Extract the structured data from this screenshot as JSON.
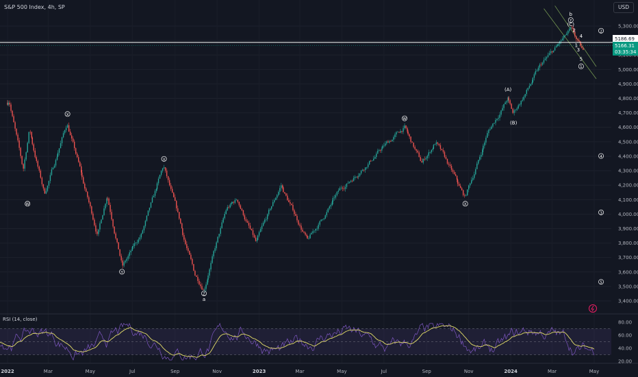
{
  "header": {
    "instrument": "S&P 500 Index, 4h, SP"
  },
  "currency": "USD",
  "price_badges": {
    "last": "5186.69",
    "current": "5166.31",
    "countdown": "03:35:34"
  },
  "rsi": {
    "label": "RSI (14, close)",
    "levels": [
      "80.00",
      "60.00",
      "40.00",
      "20.00"
    ]
  },
  "colors": {
    "up": "#26a69a",
    "down": "#ef5350",
    "rsi_line": "#7e57c2",
    "rsi_ma": "#e6df6a",
    "channel": "#9ccc65",
    "background": "#131722"
  },
  "chart_data": {
    "type": "line",
    "title": "S&P 500 Index, 4h, SP",
    "xlabel": "",
    "ylabel": "",
    "x_ticks": [
      "2022",
      "Mar",
      "May",
      "Jul",
      "Sep",
      "Nov",
      "2023",
      "Mar",
      "May",
      "Jul",
      "Sep",
      "Nov",
      "2024",
      "Mar",
      "May"
    ],
    "y_ticks": [
      "5,300.00",
      "5,200.00",
      "5,100.00",
      "5,000.00",
      "4,900.00",
      "4,800.00",
      "4,700.00",
      "4,600.00",
      "4,500.00",
      "4,400.00",
      "4,300.00",
      "4,200.00",
      "4,100.00",
      "4,000.00",
      "3,900.00",
      "3,800.00",
      "3,700.00",
      "3,600.00",
      "3,500.00",
      "3,400.00"
    ],
    "ylim": [
      3350,
      5360
    ],
    "series": [
      {
        "values": [
          [
            "2022-01-01",
            4770
          ],
          [
            "2022-01-04",
            4800
          ],
          [
            "2022-01-24",
            4300
          ],
          [
            "2022-02-02",
            4590
          ],
          [
            "2022-02-24",
            4140
          ],
          [
            "2022-03-29",
            4630
          ],
          [
            "2022-05-12",
            3860
          ],
          [
            "2022-05-26",
            4150
          ],
          [
            "2022-06-17",
            3640
          ],
          [
            "2022-07-15",
            3860
          ],
          [
            "2022-08-16",
            4325
          ],
          [
            "2022-09-30",
            3580
          ],
          [
            "2022-10-13",
            3490
          ],
          [
            "2022-11-15",
            4030
          ],
          [
            "2022-12-01",
            4100
          ],
          [
            "2022-12-28",
            3790
          ],
          [
            "2023-02-02",
            4200
          ],
          [
            "2023-03-13",
            3810
          ],
          [
            "2023-04-30",
            4170
          ],
          [
            "2023-06-30",
            4460
          ],
          [
            "2023-07-31",
            4600
          ],
          [
            "2023-08-25",
            4350
          ],
          [
            "2023-09-15",
            4500
          ],
          [
            "2023-10-27",
            4110
          ],
          [
            "2023-11-30",
            4570
          ],
          [
            "2023-12-28",
            4800
          ],
          [
            "2024-01-05",
            4690
          ],
          [
            "2024-02-15",
            5030
          ],
          [
            "2024-03-28",
            5264
          ],
          [
            "2024-04-02",
            5230
          ],
          [
            "2024-04-05",
            5200
          ],
          [
            "2024-04-15",
            5110
          ]
        ]
      }
    ],
    "wave_labels": [
      {
        "text": "W",
        "x": "2022-01-30",
        "y": 4060,
        "circled": true
      },
      {
        "text": "X",
        "x": "2022-03-29",
        "y": 4680,
        "circled": true
      },
      {
        "text": "Y",
        "x": "2022-06-16",
        "y": 3590,
        "circled": true
      },
      {
        "text": "X",
        "x": "2022-08-16",
        "y": 4370,
        "circled": true
      },
      {
        "text": "Z",
        "x": "2022-10-13",
        "y": 3440,
        "circled": true
      },
      {
        "text": "a",
        "x": "2022-10-13",
        "y": 3400,
        "circled": false
      },
      {
        "text": "W",
        "x": "2023-07-31",
        "y": 4650,
        "circled": true
      },
      {
        "text": "X",
        "x": "2023-10-27",
        "y": 4060,
        "circled": true
      },
      {
        "text": "(A)",
        "x": "2023-12-28",
        "y": 4850,
        "circled": false
      },
      {
        "text": "(B)",
        "x": "2024-01-05",
        "y": 4620,
        "circled": false
      },
      {
        "text": "b",
        "x": "2024-03-28",
        "y": 5370,
        "circled": false
      },
      {
        "text": "Y",
        "x": "2024-03-28",
        "y": 5330,
        "circled": true
      },
      {
        "text": "(C)",
        "x": "2024-03-28",
        "y": 5300,
        "circled": false
      },
      {
        "text": "2",
        "x": "2024-04-02",
        "y": 5260,
        "circled": false
      },
      {
        "text": "4",
        "x": "2024-04-12",
        "y": 5220,
        "circled": false
      },
      {
        "text": "1",
        "x": "2024-04-05",
        "y": 5155,
        "circled": false
      },
      {
        "text": "3",
        "x": "2024-04-08",
        "y": 5125,
        "circled": false
      },
      {
        "text": "5",
        "x": "2024-04-12",
        "y": 5060,
        "circled": false
      },
      {
        "text": "1",
        "x": "2024-04-12",
        "y": 5010,
        "circled": true
      },
      {
        "text": "2",
        "x": "2024-05-11",
        "y": 5256,
        "circled": true
      },
      {
        "text": "4",
        "x": "2024-05-11",
        "y": 4390,
        "circled": true
      },
      {
        "text": "3",
        "x": "2024-05-11",
        "y": 4000,
        "circled": true
      },
      {
        "text": "5",
        "x": "2024-05-11",
        "y": 3520,
        "circled": true
      }
    ],
    "horizontal_line": 5186.69,
    "legend": "none",
    "grid": true
  }
}
